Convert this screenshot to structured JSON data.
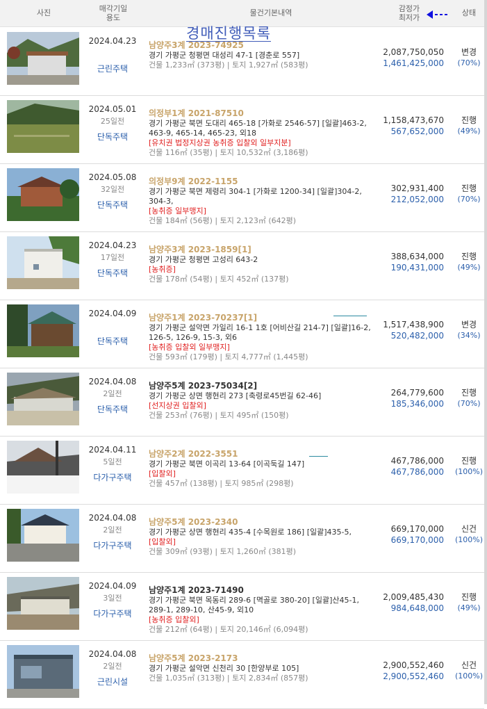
{
  "header": {
    "photo": "사진",
    "date_usage_1": "매각기일",
    "date_usage_2": "용도",
    "basic_info": "물건기본내역",
    "price_1": "감정가",
    "price_2": "최저가",
    "status": "상태"
  },
  "overlay_title": "경매진행목록",
  "rows": [
    {
      "date": "2024.04.23",
      "ago": "",
      "usage": "근린주택",
      "case": "남양주3계 2023-74925",
      "case_style": "gold",
      "address": "경기 가평군 청평면 대성리 47-1 [경춘로 557]",
      "tags": "",
      "area": "건물 1,233㎡ (373평)  |  토지 1,927㎡ (583평)",
      "appraisal": "2,087,750,050",
      "minimum": "1,461,425,000",
      "status": "변경",
      "pct": "(70%)"
    },
    {
      "date": "2024.05.01",
      "ago": "25일전",
      "usage": "단독주택",
      "case": "의정부1계 2021-87510",
      "case_style": "gold",
      "address": "경기 가평군 북면 도대리 465-18 [가화로 2546-57]  [일괄]463-2, 463-9, 465-14, 465-23, 외18",
      "tags": "[유치권  법정지상권  농취증  입찰외  일부지분]",
      "area": "건물 116㎡ (35평)  |  토지 10,532㎡ (3,186평)",
      "appraisal": "1,158,473,670",
      "minimum": "567,652,000",
      "status": "진행",
      "pct": "(49%)"
    },
    {
      "date": "2024.05.08",
      "ago": "32일전",
      "usage": "단독주택",
      "case": "의정부9계 2022-1155",
      "case_style": "gold",
      "address": "경기 가평군 북면 제령리 304-1 [가화로 1200-34]  [일괄]304-2, 304-3,",
      "tags": "[농취증  일부맹지]",
      "area": "건물 184㎡ (56평)  |  토지 2,123㎡ (642평)",
      "appraisal": "302,931,400",
      "minimum": "212,052,000",
      "status": "진행",
      "pct": "(70%)"
    },
    {
      "date": "2024.04.23",
      "ago": "17일전",
      "usage": "단독주택",
      "case": "남양주3계 2023-1859[1]",
      "case_style": "gold",
      "address": "경기 가평군 청평면 고성리 643-2",
      "tags": "[농취증]",
      "area": "건물 178㎡ (54평)  |  토지 452㎡ (137평)",
      "appraisal": "388,634,000",
      "minimum": "190,431,000",
      "status": "진행",
      "pct": "(49%)"
    },
    {
      "date": "2024.04.09",
      "ago": "",
      "usage": "단독주택",
      "case": "남양주1계 2023-70237[1]",
      "case_style": "gold",
      "address": "경기 가평군 설악면 가일리 16-1 1호 [어비산길 214-7]  [일괄]16-2, 126-5, 126-9, 15-3, 외6",
      "tags": "[농취증  입찰외  일부맹지]",
      "area": "건물 593㎡ (179평)  |  토지 4,777㎡ (1,445평)",
      "appraisal": "1,517,438,900",
      "minimum": "520,482,000",
      "status": "변경",
      "pct": "(34%)"
    },
    {
      "date": "2024.04.08",
      "ago": "2일전",
      "usage": "단독주택",
      "case": "남양주5계 2023-75034[2]",
      "case_style": "black",
      "address": "경기 가평군 상면 행현리 273 [축령로45번길 62-46]",
      "tags": "[선지상권  입찰외]",
      "area": "건물 253㎡ (76평)  |  토지 495㎡ (150평)",
      "appraisal": "264,779,600",
      "minimum": "185,346,000",
      "status": "진행",
      "pct": "(70%)"
    },
    {
      "date": "2024.04.11",
      "ago": "5일전",
      "usage": "다가구주택",
      "case": "남양주2계 2022-3551",
      "case_style": "gold",
      "address": "경기 가평군 북면 이곡리 13-64 [이곡둑길 147]",
      "tags": "[입찰외]",
      "area": "건물 457㎡ (138평)  |  토지 985㎡ (298평)",
      "appraisal": "467,786,000",
      "minimum": "467,786,000",
      "status": "진행",
      "pct": "(100%)"
    },
    {
      "date": "2024.04.08",
      "ago": "2일전",
      "usage": "다가구주택",
      "case": "남양주5계 2023-2340",
      "case_style": "gold",
      "address": "경기 가평군 상면 행현리 435-4 [수목원로 186]  [일괄]435-5,",
      "tags": "[입찰외]",
      "area": "건물 309㎡ (93평)  |  토지 1,260㎡ (381평)",
      "appraisal": "669,170,000",
      "minimum": "669,170,000",
      "status": "신건",
      "pct": "(100%)"
    },
    {
      "date": "2024.04.09",
      "ago": "3일전",
      "usage": "다가구주택",
      "case": "남양주1계 2023-71490",
      "case_style": "black",
      "address": "경기 가평군 북면 목동리 289-6 [멱골로 380-20]  [일괄]산45-1, 289-1, 289-10, 산45-9, 외10",
      "tags": "[농취증  입찰외]",
      "area": "건물 212㎡ (64평)  |  토지 20,146㎡ (6,094평)",
      "appraisal": "2,009,485,430",
      "minimum": "984,648,000",
      "status": "진행",
      "pct": "(49%)"
    },
    {
      "date": "2024.04.08",
      "ago": "2일전",
      "usage": "근린시설",
      "case": "남양주5계 2023-2173",
      "case_style": "gold",
      "address": "경기 가평군 설악면 신천리 30 [한양부로 105]",
      "tags": "",
      "area": "건물 1,035㎡ (313평)  |  토지 2,834㎡ (857평)",
      "appraisal": "2,900,552,460",
      "minimum": "2,900,552,460",
      "status": "신건",
      "pct": "(100%)"
    }
  ],
  "thumbs": [
    "house-mountain-photo",
    "field-grass-photo",
    "brick-house-photo",
    "white-house-photo",
    "cabin-photo",
    "greenhouse-photo",
    "snow-house-photo",
    "villa-photo",
    "hillside-building-photo",
    "commercial-building-photo"
  ],
  "colors": {
    "case_gold": "#c8a46a",
    "price_blue": "#2b5fab",
    "tag_red": "#e02020",
    "title_blue": "#3f5bb8"
  }
}
